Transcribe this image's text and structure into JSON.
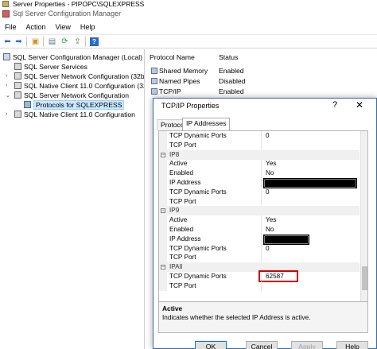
{
  "background_window": {
    "title": "Server Properties - PIPOPC\\SQLEXPRESS"
  },
  "app": {
    "title": "Sql Server Configuration Manager"
  },
  "menu": [
    "File",
    "Action",
    "View",
    "Help"
  ],
  "toolbar_icons": [
    "back-arrow-icon",
    "forward-arrow-icon",
    "up-folder-icon",
    "show-hide-tree-icon",
    "refresh-icon",
    "export-list-icon",
    "help-icon"
  ],
  "tree": {
    "root": "SQL Server Configuration Manager (Local)",
    "items": [
      "SQL Server Services",
      "SQL Server Network Configuration (32bit",
      "SQL Native Client 11.0 Configuration (32bi",
      "SQL Server Network Configuration",
      "Protocols for SQLEXPRESS",
      "SQL Native Client 11.0 Configuration"
    ],
    "selected": "Protocols for SQLEXPRESS"
  },
  "list": {
    "columns": [
      "Protocol Name",
      "Status"
    ],
    "rows": [
      {
        "name": "Shared Memory",
        "status": "Enabled"
      },
      {
        "name": "Named Pipes",
        "status": "Disabled"
      },
      {
        "name": "TCP/IP",
        "status": "Enabled"
      }
    ]
  },
  "dialog": {
    "title": "TCP/IP Properties",
    "help_glyph": "?",
    "close_glyph": "✕",
    "tabs": [
      "Protocol",
      "IP Addresses"
    ],
    "active_tab": "IP Addresses",
    "rows": [
      {
        "type": "prop",
        "key": "TCP Dynamic Ports",
        "value": "0"
      },
      {
        "type": "prop",
        "key": "TCP Port",
        "value": ""
      },
      {
        "type": "cat",
        "key": "IP8"
      },
      {
        "type": "prop",
        "key": "Active",
        "value": "Yes"
      },
      {
        "type": "prop",
        "key": "Enabled",
        "value": "No"
      },
      {
        "type": "prop",
        "key": "IP Address",
        "value": "",
        "redacted": true
      },
      {
        "type": "prop",
        "key": "TCP Dynamic Ports",
        "value": "0"
      },
      {
        "type": "prop",
        "key": "TCP Port",
        "value": ""
      },
      {
        "type": "cat",
        "key": "IP9"
      },
      {
        "type": "prop",
        "key": "Active",
        "value": "Yes"
      },
      {
        "type": "prop",
        "key": "Enabled",
        "value": "No"
      },
      {
        "type": "prop",
        "key": "IP Address",
        "value": "",
        "redacted": true
      },
      {
        "type": "prop",
        "key": "TCP Dynamic Ports",
        "value": "0"
      },
      {
        "type": "prop",
        "key": "TCP Port",
        "value": ""
      },
      {
        "type": "cat",
        "key": "IPAll"
      },
      {
        "type": "prop",
        "key": "TCP Dynamic Ports",
        "value": "62587",
        "highlight": true
      },
      {
        "type": "prop",
        "key": "TCP Port",
        "value": ""
      }
    ],
    "description": {
      "title": "Active",
      "text": "Indicates whether the selected IP Address is active."
    },
    "buttons": [
      "OK",
      "Cancel",
      "Apply",
      "Help"
    ],
    "highlight_color": "#d00000"
  }
}
